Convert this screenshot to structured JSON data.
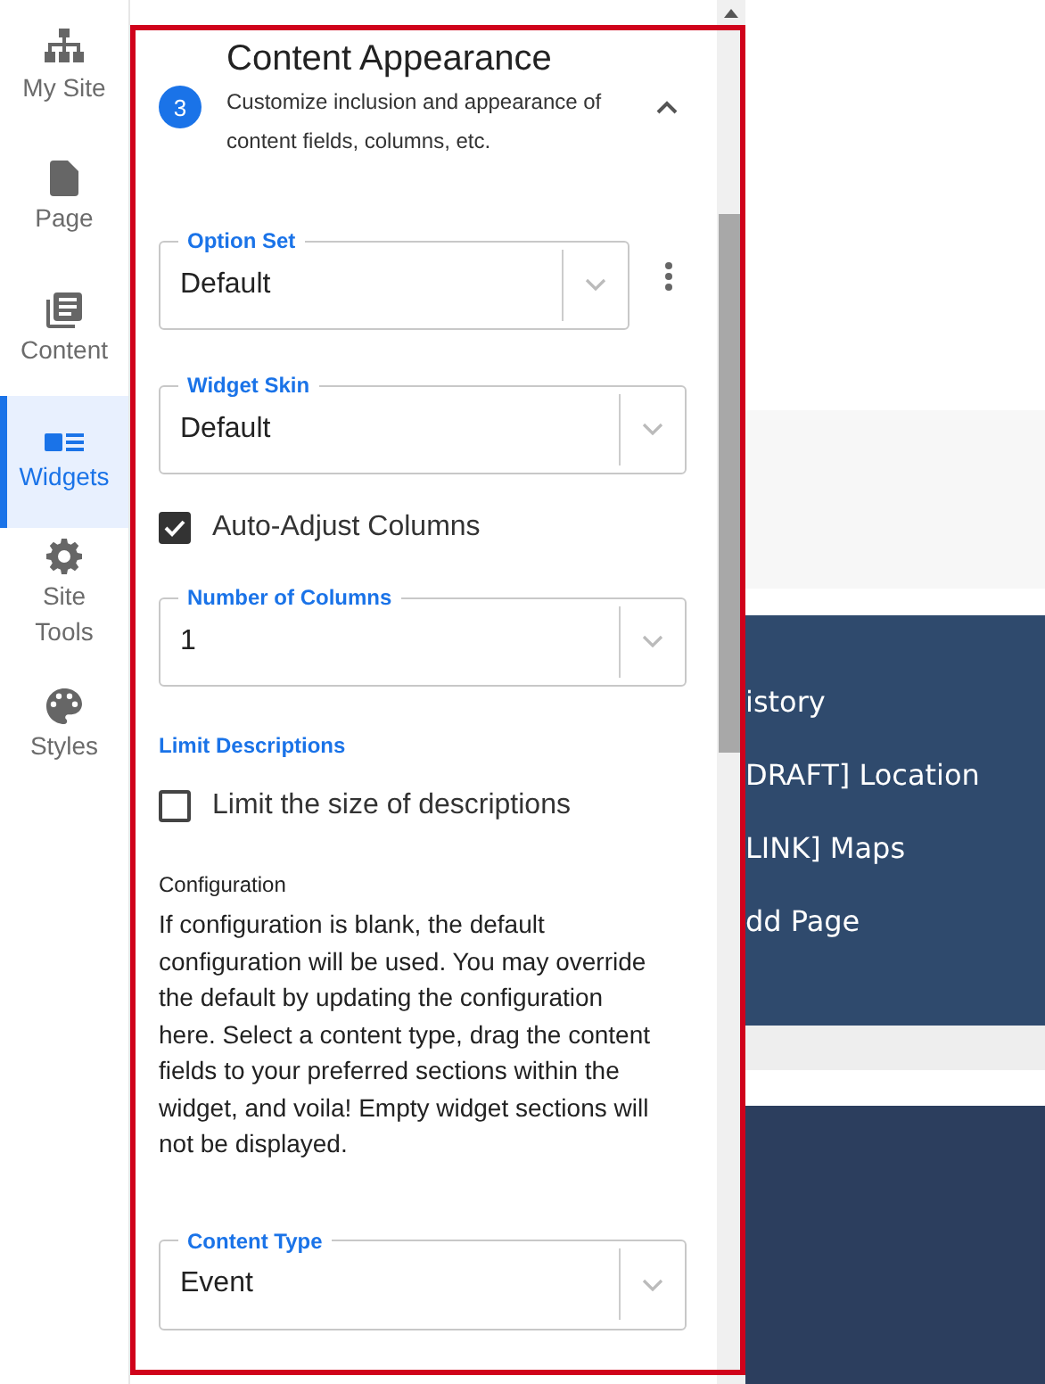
{
  "nav": [
    {
      "label": "My Site",
      "selected": false
    },
    {
      "label": "Page",
      "selected": false
    },
    {
      "label": "Content",
      "selected": false
    },
    {
      "label": "Widgets",
      "selected": true
    },
    {
      "label": "Site Tools",
      "selected": false
    },
    {
      "label": "Styles",
      "selected": false
    }
  ],
  "panel": {
    "step": "3",
    "title": "Content Appearance",
    "subtitle": "Customize inclusion and appearance of content fields, columns, etc.",
    "expanded": true,
    "fields": [
      {
        "kind": "select",
        "label": "Option Set",
        "value": "Default",
        "menu": true
      },
      {
        "kind": "select",
        "label": "Widget Skin",
        "value": "Default"
      },
      {
        "kind": "checkbox",
        "label": "Auto-Adjust Columns",
        "checked": true
      },
      {
        "kind": "select",
        "label": "Number of Columns",
        "value": "1"
      },
      {
        "kind": "heading",
        "text": "Limit Descriptions"
      },
      {
        "kind": "checkbox",
        "label": "Limit the size of descriptions",
        "checked": false
      },
      {
        "kind": "note",
        "title": "Configuration",
        "text": "If configuration is blank, the default configuration will be used. You may override the default by updating the configuration here. Select a content type, drag the content fields to your preferred sections within the widget, and voila! Empty widget sections will not be displayed."
      },
      {
        "kind": "select",
        "label": "Content Type",
        "value": "Event"
      }
    ]
  },
  "page_menu": [
    "istory",
    "DRAFT] Location",
    "LINK] Maps",
    "dd Page"
  ]
}
